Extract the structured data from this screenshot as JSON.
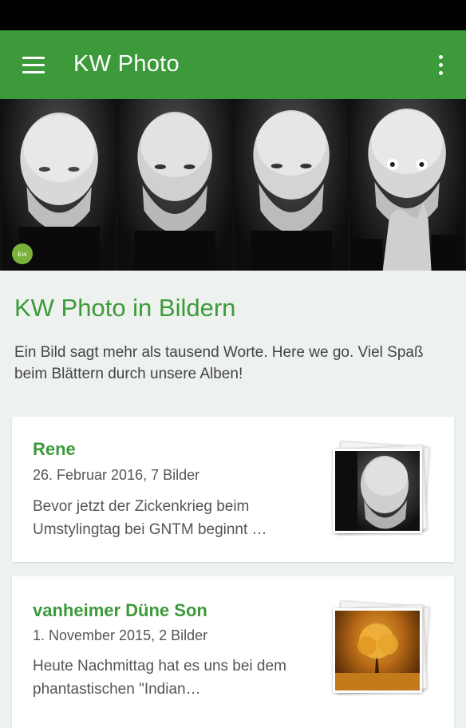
{
  "app_bar": {
    "title": "KW Photo",
    "menu_icon": "hamburger-menu-icon",
    "overflow_icon": "more-vert-icon",
    "color": "#3c9a3a"
  },
  "hero": {
    "logo_text": "kw",
    "tile_count": 4
  },
  "intro": {
    "title": "KW Photo in Bildern",
    "text": "Ein Bild sagt mehr als tausend Worte. Here we go. Viel Spaß beim Blättern durch unsere Alben!"
  },
  "albums": [
    {
      "title": "Rene",
      "meta": "26. Februar 2016, 7 Bilder",
      "description": "Bevor jetzt der Zickenkrieg beim Umstylingtag bei GNTM beginnt …"
    },
    {
      "title": "vanheimer Düne          Son",
      "meta": "1. November 2015, 2 Bilder",
      "description": "Heute Nachmittag hat es uns bei dem phantastischen \"Indian…"
    }
  ]
}
